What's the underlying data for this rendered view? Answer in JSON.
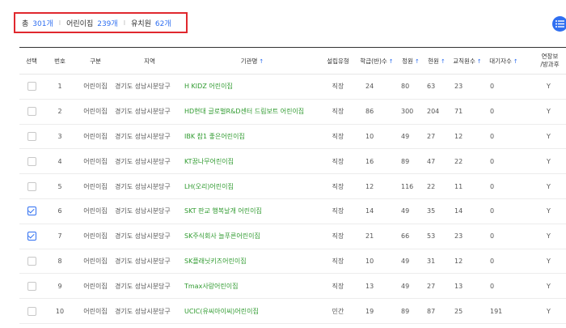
{
  "summary": {
    "total_label": "총",
    "total_value": "301개",
    "daycare_label": "어린이집",
    "daycare_value": "239개",
    "kinder_label": "유치원",
    "kinder_value": "62개",
    "separator": "I"
  },
  "columns": [
    {
      "key": "select",
      "label": "선택"
    },
    {
      "key": "no",
      "label": "번호"
    },
    {
      "key": "type",
      "label": "구분"
    },
    {
      "key": "region",
      "label": "지역"
    },
    {
      "key": "name",
      "label": "기관명",
      "sort": "↑"
    },
    {
      "key": "est",
      "label": "설립유형"
    },
    {
      "key": "classes",
      "label": "학급(반)수",
      "sort": "↑"
    },
    {
      "key": "capacity",
      "label": "정원",
      "sort": "↑"
    },
    {
      "key": "current",
      "label": "현원",
      "sort": "↑"
    },
    {
      "key": "staff",
      "label": "교직원수",
      "sort": "↑"
    },
    {
      "key": "waiting",
      "label": "대기자수",
      "sort": "↑"
    },
    {
      "key": "extended",
      "label_line1": "연장보",
      "label_line2": "/방과후"
    }
  ],
  "rows": [
    {
      "checked": false,
      "no": "1",
      "type": "어린이집",
      "region": "경기도 성남시분당구",
      "name": "H KIDZ 어린이집",
      "est": "직장",
      "classes": "24",
      "capacity": "80",
      "current": "63",
      "staff": "23",
      "waiting": "0",
      "extended": "Y"
    },
    {
      "checked": false,
      "no": "2",
      "type": "어린이집",
      "region": "경기도 성남시분당구",
      "name": "HD현대 글로벌R&D센터 드림보트 어린이집",
      "est": "직장",
      "classes": "86",
      "capacity": "300",
      "current": "204",
      "staff": "71",
      "waiting": "0",
      "extended": "Y"
    },
    {
      "checked": false,
      "no": "3",
      "type": "어린이집",
      "region": "경기도 성남시분당구",
      "name": "IBK 참1 좋은어린이집",
      "est": "직장",
      "classes": "10",
      "capacity": "49",
      "current": "27",
      "staff": "12",
      "waiting": "0",
      "extended": "Y"
    },
    {
      "checked": false,
      "no": "4",
      "type": "어린이집",
      "region": "경기도 성남시분당구",
      "name": "KT꿈나무어린이집",
      "est": "직장",
      "classes": "16",
      "capacity": "89",
      "current": "47",
      "staff": "22",
      "waiting": "0",
      "extended": "Y"
    },
    {
      "checked": false,
      "no": "5",
      "type": "어린이집",
      "region": "경기도 성남시분당구",
      "name": "LH(오리)어린이집",
      "est": "직장",
      "classes": "12",
      "capacity": "116",
      "current": "22",
      "staff": "11",
      "waiting": "0",
      "extended": "Y"
    },
    {
      "checked": true,
      "no": "6",
      "type": "어린이집",
      "region": "경기도 성남시분당구",
      "name": "SKT 판교 행복날개 어린이집",
      "est": "직장",
      "classes": "14",
      "capacity": "49",
      "current": "35",
      "staff": "14",
      "waiting": "0",
      "extended": "Y"
    },
    {
      "checked": true,
      "no": "7",
      "type": "어린이집",
      "region": "경기도 성남시분당구",
      "name": "SK주식회사 늘푸른어린이집",
      "est": "직장",
      "classes": "21",
      "capacity": "66",
      "current": "53",
      "staff": "23",
      "waiting": "0",
      "extended": "Y"
    },
    {
      "checked": false,
      "no": "8",
      "type": "어린이집",
      "region": "경기도 성남시분당구",
      "name": "SK플래닛키즈어린이집",
      "est": "직장",
      "classes": "10",
      "capacity": "49",
      "current": "31",
      "staff": "12",
      "waiting": "0",
      "extended": "Y"
    },
    {
      "checked": false,
      "no": "9",
      "type": "어린이집",
      "region": "경기도 성남시분당구",
      "name": "Tmax사랑어린이집",
      "est": "직장",
      "classes": "13",
      "capacity": "49",
      "current": "27",
      "staff": "13",
      "waiting": "0",
      "extended": "Y"
    },
    {
      "checked": false,
      "no": "10",
      "type": "어린이집",
      "region": "경기도 성남시분당구",
      "name": "UCIC(유씨아이씨)어린이집",
      "est": "민간",
      "classes": "19",
      "capacity": "89",
      "current": "87",
      "staff": "25",
      "waiting": "191",
      "extended": "Y"
    }
  ],
  "colors": {
    "accent": "#2f6ff1",
    "org_name": "#2e9a2e",
    "highlight_border": "#e0282e"
  },
  "icons": {
    "menu": "list-menu-icon"
  }
}
